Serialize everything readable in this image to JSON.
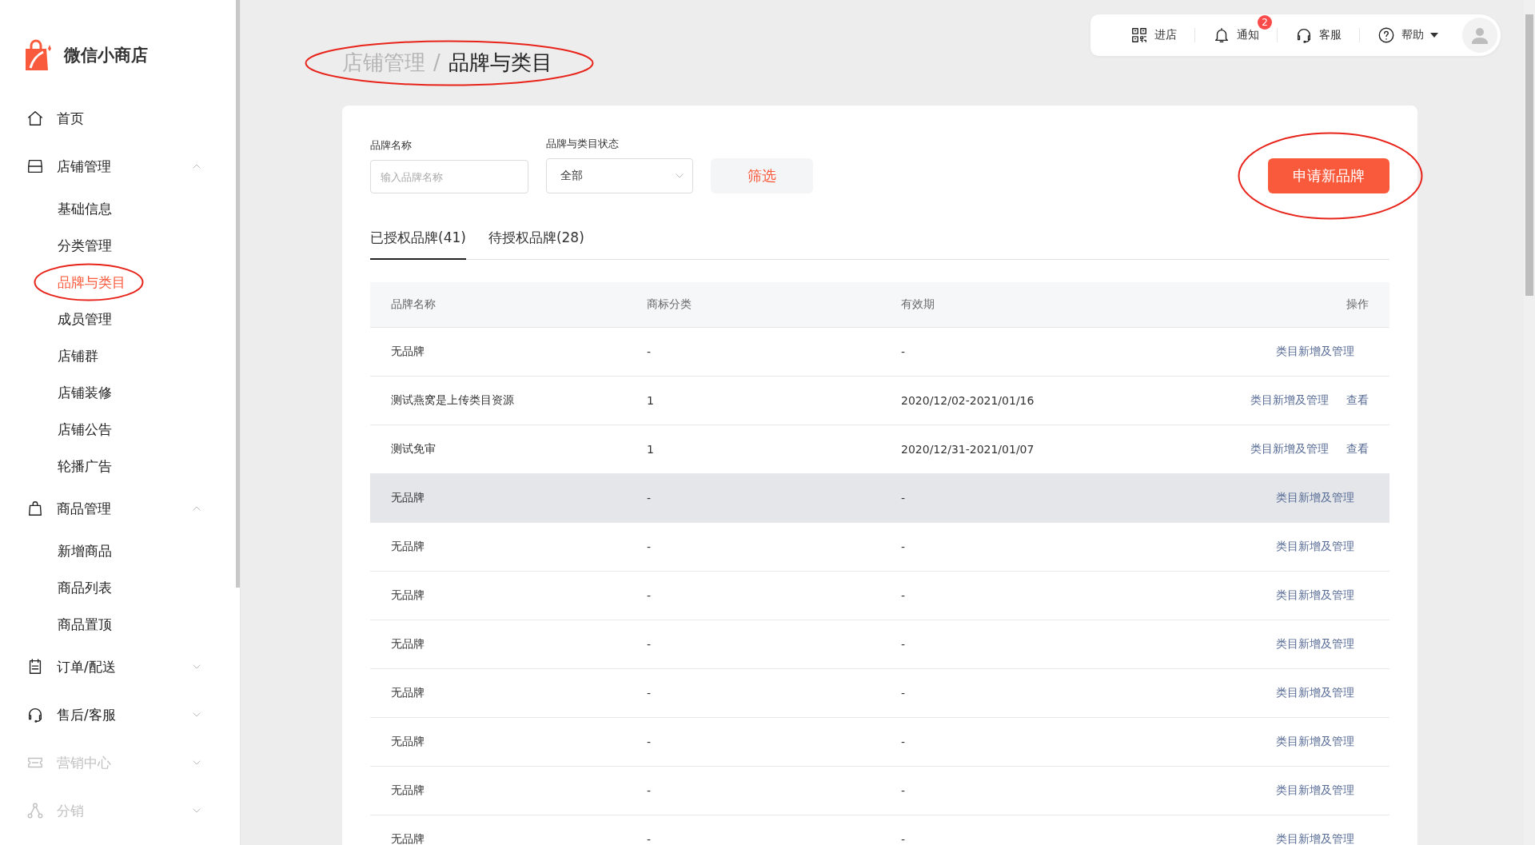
{
  "sidebar": {
    "logo_text": "微信小商店",
    "groups": [
      {
        "label": "首页",
        "disabled": false
      },
      {
        "label": "店铺管理",
        "expanded": true,
        "disabled": false,
        "children": [
          {
            "label": "基础信息",
            "selected": false,
            "circled": false
          },
          {
            "label": "分类管理",
            "selected": false,
            "circled": false
          },
          {
            "label": "品牌与类目",
            "selected": true,
            "circled": true
          },
          {
            "label": "成员管理",
            "selected": false,
            "circled": false
          },
          {
            "label": "店铺群",
            "selected": false,
            "circled": false
          },
          {
            "label": "店铺装修",
            "selected": false,
            "circled": false
          },
          {
            "label": "店铺公告",
            "selected": false,
            "circled": false
          },
          {
            "label": "轮播广告",
            "selected": false,
            "circled": false
          }
        ]
      },
      {
        "label": "商品管理",
        "expanded": true,
        "disabled": false,
        "children": [
          {
            "label": "新增商品",
            "selected": false,
            "circled": false
          },
          {
            "label": "商品列表",
            "selected": false,
            "circled": false
          },
          {
            "label": "商品置顶",
            "selected": false,
            "circled": false
          }
        ]
      },
      {
        "label": "订单/配送",
        "expanded": false,
        "disabled": false
      },
      {
        "label": "售后/客服",
        "expanded": false,
        "disabled": false
      },
      {
        "label": "营销中心",
        "expanded": false,
        "disabled": true
      },
      {
        "label": "分销",
        "expanded": false,
        "disabled": true
      }
    ]
  },
  "top_bar": {
    "items": [
      {
        "label": "进店"
      },
      {
        "label": "通知",
        "badge": "2"
      },
      {
        "label": "客服"
      },
      {
        "label": "帮助"
      }
    ]
  },
  "breadcrumb": {
    "parent": "店铺管理",
    "separator": "/",
    "current": "品牌与类目",
    "circled": true
  },
  "filters": {
    "brand_name": {
      "label": "品牌名称",
      "placeholder": "输入品牌名称"
    },
    "status": {
      "label": "品牌与类目状态",
      "value": "全部"
    },
    "filter_button": "筛选",
    "apply_button": {
      "label": "申请新品牌",
      "circled": true
    }
  },
  "tabs": [
    {
      "label": "已授权品牌(41)",
      "selected": true
    },
    {
      "label": "待授权品牌(28)",
      "selected": false
    }
  ],
  "table": {
    "columns": [
      "品牌名称",
      "商标分类",
      "有效期",
      "操作"
    ],
    "rows": [
      {
        "cells": [
          "无品牌",
          "-",
          "-"
        ],
        "actions": [
          "类目新增及管理"
        ],
        "hovered": false
      },
      {
        "cells": [
          "测试燕窝是上传类目资源",
          "1",
          "2020/12/02-2021/01/16"
        ],
        "actions": [
          "类目新增及管理",
          "查看"
        ],
        "hovered": false
      },
      {
        "cells": [
          "测试免审",
          "1",
          "2020/12/31-2021/01/07"
        ],
        "actions": [
          "类目新增及管理",
          "查看"
        ],
        "hovered": false
      },
      {
        "cells": [
          "无品牌",
          "-",
          "-"
        ],
        "actions": [
          "类目新增及管理"
        ],
        "hovered": true
      },
      {
        "cells": [
          "无品牌",
          "-",
          "-"
        ],
        "actions": [
          "类目新增及管理"
        ],
        "hovered": false
      },
      {
        "cells": [
          "无品牌",
          "-",
          "-"
        ],
        "actions": [
          "类目新增及管理"
        ],
        "hovered": false
      },
      {
        "cells": [
          "无品牌",
          "-",
          "-"
        ],
        "actions": [
          "类目新增及管理"
        ],
        "hovered": false
      },
      {
        "cells": [
          "无品牌",
          "-",
          "-"
        ],
        "actions": [
          "类目新增及管理"
        ],
        "hovered": false
      },
      {
        "cells": [
          "无品牌",
          "-",
          "-"
        ],
        "actions": [
          "类目新增及管理"
        ],
        "hovered": false
      },
      {
        "cells": [
          "无品牌",
          "-",
          "-"
        ],
        "actions": [
          "类目新增及管理"
        ],
        "hovered": false
      },
      {
        "cells": [
          "无品牌",
          "-",
          "-"
        ],
        "actions": [
          "类目新增及管理"
        ],
        "hovered": false
      }
    ]
  }
}
